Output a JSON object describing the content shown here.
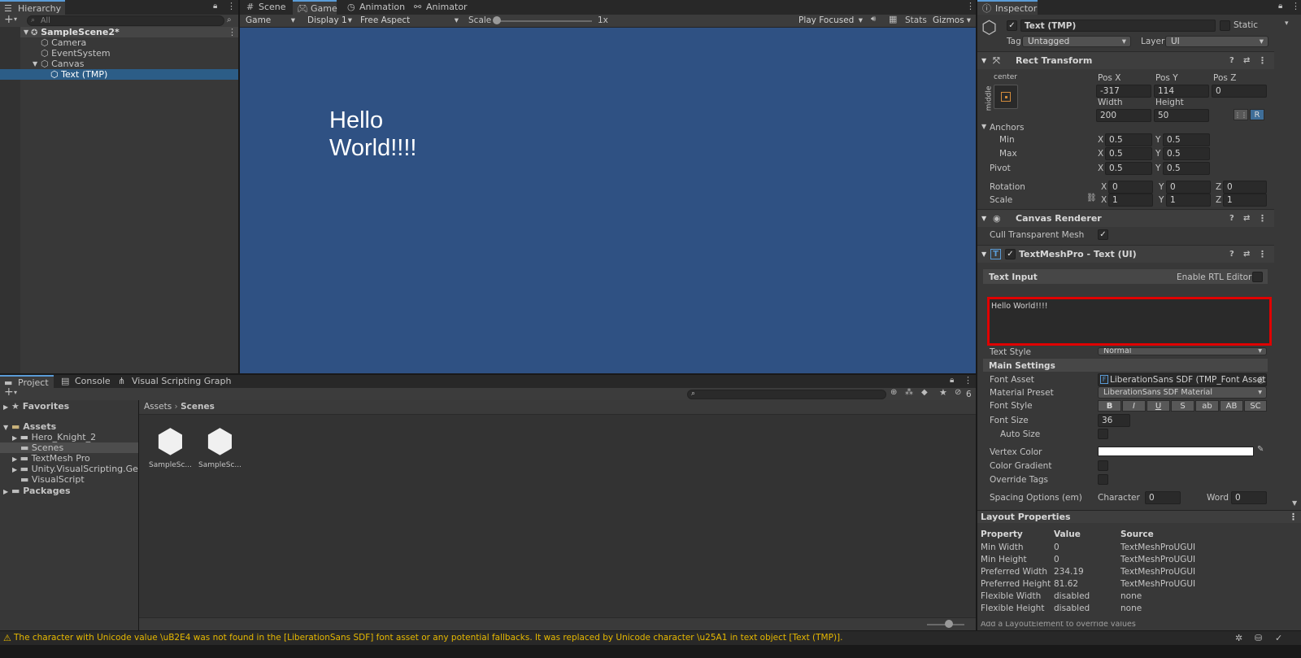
{
  "hierarchy": {
    "tab": "Hierarchy",
    "search_placeholder": "All",
    "items": [
      {
        "label": "SampleScene2*"
      },
      {
        "label": "Camera"
      },
      {
        "label": "EventSystem"
      },
      {
        "label": "Canvas"
      },
      {
        "label": "Text (TMP)"
      }
    ]
  },
  "center_tabs": {
    "scene": "Scene",
    "game": "Game",
    "animation": "Animation",
    "animator": "Animator"
  },
  "game_toolbar": {
    "mode": "Game",
    "display": "Display 1",
    "aspect": "Free Aspect",
    "scale_label": "Scale",
    "scale_value": "1x",
    "play_focused": "Play Focused",
    "stats": "Stats",
    "gizmos": "Gizmos"
  },
  "game_view": {
    "text_line1": "Hello",
    "text_line2": "World!!!!",
    "bg_color": "#2f5183"
  },
  "inspector": {
    "tab": "Inspector",
    "object_name": "Text (TMP)",
    "static_label": "Static",
    "tag_label": "Tag",
    "tag_value": "Untagged",
    "layer_label": "Layer",
    "layer_value": "UI",
    "rect_transform": {
      "title": "Rect Transform",
      "anchor_h": "center",
      "anchor_v": "middle",
      "pos_x_label": "Pos X",
      "pos_y_label": "Pos Y",
      "pos_z_label": "Pos Z",
      "pos_x": "-317",
      "pos_y": "114",
      "pos_z": "0",
      "width_label": "Width",
      "height_label": "Height",
      "width": "200",
      "height": "50",
      "r_button": "R",
      "anchors_label": "Anchors",
      "min_label": "Min",
      "max_label": "Max",
      "pivot_label": "Pivot",
      "min_x": "0.5",
      "min_y": "0.5",
      "max_x": "0.5",
      "max_y": "0.5",
      "pivot_x": "0.5",
      "pivot_y": "0.5",
      "rotation_label": "Rotation",
      "rot_x": "0",
      "rot_y": "0",
      "rot_z": "0",
      "scale_label": "Scale",
      "scale_x": "1",
      "scale_y": "1",
      "scale_z": "1",
      "x": "X",
      "y": "Y",
      "z": "Z"
    },
    "canvas_renderer": {
      "title": "Canvas Renderer",
      "cull_label": "Cull Transparent Mesh"
    },
    "tmp": {
      "title": "TextMeshPro - Text (UI)",
      "text_input_label": "Text Input",
      "rtl_label": "Enable RTL Editor",
      "text_value": "Hello World!!!!",
      "text_style_label": "Text Style",
      "text_style_value": "Normal",
      "main_settings": "Main Settings",
      "font_asset_label": "Font Asset",
      "font_asset_value": "LiberationSans SDF (TMP_Font Asset)",
      "material_label": "Material Preset",
      "material_value": "LiberationSans SDF Material",
      "font_style_label": "Font Style",
      "style_buttons": [
        "B",
        "I",
        "U",
        "S",
        "ab",
        "AB",
        "SC"
      ],
      "font_size_label": "Font Size",
      "font_size_value": "36",
      "auto_size_label": "Auto Size",
      "vertex_color_label": "Vertex Color",
      "color_gradient_label": "Color Gradient",
      "override_tags_label": "Override Tags",
      "spacing_label": "Spacing Options (em)",
      "character_label": "Character",
      "character_value": "0",
      "word_label": "Word",
      "word_value": "0"
    },
    "layout": {
      "title": "Layout Properties",
      "headers": [
        "Property",
        "Value",
        "Source"
      ],
      "rows": [
        [
          "Min Width",
          "0",
          "TextMeshProUGUI"
        ],
        [
          "Min Height",
          "0",
          "TextMeshProUGUI"
        ],
        [
          "Preferred Width",
          "234.19",
          "TextMeshProUGUI"
        ],
        [
          "Preferred Height",
          "81.62",
          "TextMeshProUGUI"
        ],
        [
          "Flexible Width",
          "disabled",
          "none"
        ],
        [
          "Flexible Height",
          "disabled",
          "none"
        ]
      ],
      "footer": "Add a LayoutElement to override values"
    }
  },
  "project": {
    "tabs": {
      "project": "Project",
      "console": "Console",
      "vsg": "Visual Scripting Graph"
    },
    "favorites": "Favorites",
    "assets": "Assets",
    "folders": [
      "Hero_Knight_2",
      "Scenes",
      "TextMesh Pro",
      "Unity.VisualScripting.Genera",
      "VisualScript"
    ],
    "packages": "Packages",
    "breadcrumb": [
      "Assets",
      "Scenes"
    ],
    "files": [
      {
        "label": "SampleSc..."
      },
      {
        "label": "SampleSc..."
      }
    ],
    "hidden_count": "6"
  },
  "status_bar": {
    "message": "The character with Unicode value \\uB2E4 was not found in the [LiberationSans SDF] font asset or any potential fallbacks. It was replaced by Unicode character \\u25A1 in text object [Text (TMP)]."
  },
  "colors": {
    "accent": "#2c5d87",
    "highlight": "#e00000",
    "warning": "#e6b800"
  }
}
